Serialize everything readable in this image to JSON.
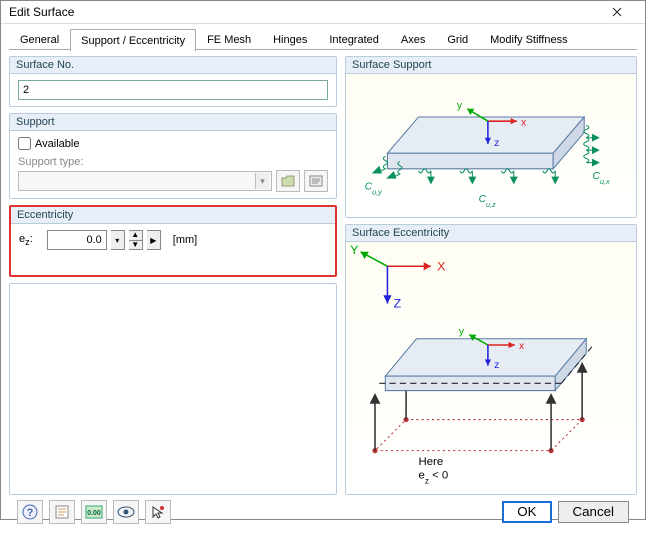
{
  "window": {
    "title": "Edit Surface"
  },
  "tabs": [
    "General",
    "Support / Eccentricity",
    "FE Mesh",
    "Hinges",
    "Integrated",
    "Axes",
    "Grid",
    "Modify Stiffness"
  ],
  "active_tab": 1,
  "surface_no": {
    "title": "Surface No.",
    "value": "2"
  },
  "support": {
    "title": "Support",
    "available_label": "Available",
    "available_checked": false,
    "type_label": "Support type:"
  },
  "eccentricity": {
    "title": "Eccentricity",
    "label_html": "e<sub>z</sub>:",
    "label": "ez:",
    "value": "0.0",
    "unit": "[mm]"
  },
  "right": {
    "support_title": "Surface Support",
    "ecc_title": "Surface Eccentricity",
    "axes": {
      "x": "x",
      "y": "y",
      "z": "z",
      "X": "X",
      "Y": "Y",
      "Z": "Z"
    },
    "cu": {
      "x": "Cu,x",
      "y": "Cu,y",
      "z": "Cu,z"
    },
    "ecc_note1": "Here",
    "ecc_note2_html": "e<sub>z</sub> < 0",
    "ecc_note2": "ez < 0"
  },
  "buttons": {
    "ok": "OK",
    "cancel": "Cancel"
  }
}
